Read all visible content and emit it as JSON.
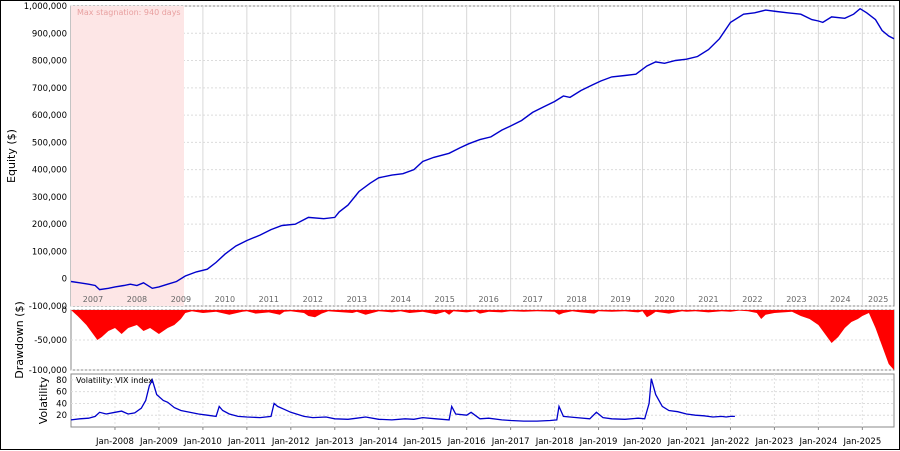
{
  "chart_data": [
    {
      "type": "line",
      "ylabel": "Equity ($)",
      "ylim": [
        -100000,
        1000000
      ],
      "y_ticks": [
        "1,000,000",
        "900,000",
        "800,000",
        "700,000",
        "600,000",
        "500,000",
        "400,000",
        "300,000",
        "200,000",
        "100,000",
        "0",
        "-100,000"
      ],
      "year_labels": [
        "2007",
        "2008",
        "2009",
        "2010",
        "2011",
        "2012",
        "2013",
        "2014",
        "2015",
        "2016",
        "2017",
        "2018",
        "2019",
        "2020",
        "2021",
        "2022",
        "2023",
        "2024",
        "2025"
      ],
      "annotation": "Max stagnation: 940 days",
      "stagnation_range": [
        2007.0,
        2009.57
      ],
      "x_range": [
        2007.0,
        2025.72
      ],
      "series": [
        {
          "color": "#0000cc",
          "x": [
            2007.0,
            2007.2,
            2007.4,
            2007.55,
            2007.65,
            2007.85,
            2008.0,
            2008.2,
            2008.35,
            2008.5,
            2008.65,
            2008.85,
            2009.0,
            2009.2,
            2009.4,
            2009.6,
            2009.85,
            2010.1,
            2010.3,
            2010.5,
            2010.75,
            2011.0,
            2011.3,
            2011.55,
            2011.8,
            2012.1,
            2012.4,
            2012.75,
            2013.0,
            2013.1,
            2013.3,
            2013.55,
            2013.8,
            2014.0,
            2014.3,
            2014.55,
            2014.8,
            2015.0,
            2015.25,
            2015.6,
            2015.85,
            2016.05,
            2016.3,
            2016.55,
            2016.8,
            2017.0,
            2017.25,
            2017.5,
            2017.75,
            2018.0,
            2018.2,
            2018.35,
            2018.6,
            2018.85,
            2019.05,
            2019.3,
            2019.6,
            2019.85,
            2020.1,
            2020.3,
            2020.5,
            2020.75,
            2021.0,
            2021.25,
            2021.5,
            2021.75,
            2022.0,
            2022.3,
            2022.55,
            2022.8,
            2023.05,
            2023.3,
            2023.6,
            2023.85,
            2024.0,
            2024.1,
            2024.3,
            2024.6,
            2024.8,
            2024.95,
            2025.1,
            2025.3,
            2025.45,
            2025.6,
            2025.72
          ],
          "y": [
            -10000,
            -15000,
            -20000,
            -25000,
            -40000,
            -35000,
            -30000,
            -25000,
            -20000,
            -25000,
            -15000,
            -35000,
            -30000,
            -20000,
            -10000,
            10000,
            25000,
            35000,
            60000,
            90000,
            120000,
            140000,
            160000,
            180000,
            195000,
            200000,
            225000,
            220000,
            225000,
            245000,
            270000,
            320000,
            350000,
            370000,
            380000,
            385000,
            400000,
            430000,
            445000,
            460000,
            480000,
            495000,
            510000,
            520000,
            545000,
            560000,
            580000,
            610000,
            630000,
            650000,
            670000,
            665000,
            690000,
            710000,
            725000,
            740000,
            745000,
            750000,
            780000,
            795000,
            790000,
            800000,
            805000,
            815000,
            840000,
            880000,
            940000,
            970000,
            975000,
            985000,
            980000,
            975000,
            970000,
            950000,
            945000,
            940000,
            960000,
            955000,
            970000,
            990000,
            975000,
            950000,
            910000,
            890000,
            880000
          ]
        }
      ]
    },
    {
      "type": "area",
      "ylabel": "Drawdown ($)",
      "ylim": [
        -100000,
        0
      ],
      "y_ticks": [
        "0",
        "-50,000",
        "-100,000"
      ],
      "series": [
        {
          "color": "#ff0000",
          "x": [
            2007.0,
            2007.15,
            2007.35,
            2007.5,
            2007.6,
            2007.7,
            2007.85,
            2008.0,
            2008.15,
            2008.3,
            2008.5,
            2008.65,
            2008.8,
            2009.0,
            2009.2,
            2009.35,
            2009.5,
            2009.6,
            2009.75,
            2010.0,
            2010.3,
            2010.6,
            2010.9,
            2011.0,
            2011.2,
            2011.5,
            2011.75,
            2011.85,
            2012.0,
            2012.3,
            2012.4,
            2012.55,
            2012.7,
            2012.85,
            2013.0,
            2013.4,
            2013.5,
            2013.7,
            2014.0,
            2014.3,
            2014.5,
            2014.7,
            2015.0,
            2015.3,
            2015.5,
            2015.6,
            2015.7,
            2016.0,
            2016.2,
            2016.3,
            2016.5,
            2016.8,
            2017.0,
            2017.3,
            2017.6,
            2018.0,
            2018.1,
            2018.2,
            2018.4,
            2018.6,
            2018.9,
            2019.0,
            2019.3,
            2019.6,
            2019.9,
            2020.0,
            2020.1,
            2020.2,
            2020.3,
            2020.6,
            2020.9,
            2021.0,
            2021.2,
            2021.5,
            2021.8,
            2022.0,
            2022.2,
            2022.4,
            2022.6,
            2022.7,
            2022.8,
            2023.0,
            2023.2,
            2023.4,
            2023.6,
            2023.8,
            2024.0,
            2024.15,
            2024.3,
            2024.45,
            2024.6,
            2024.75,
            2024.9,
            2025.0,
            2025.15,
            2025.3,
            2025.45,
            2025.6,
            2025.72
          ],
          "y": [
            0,
            -10000,
            -25000,
            -40000,
            -50000,
            -45000,
            -35000,
            -30000,
            -40000,
            -30000,
            -25000,
            -35000,
            -30000,
            -40000,
            -30000,
            -25000,
            -15000,
            -5000,
            -2000,
            -5000,
            -3000,
            -8000,
            -3000,
            -2000,
            -6000,
            -4000,
            -8000,
            -3000,
            -2000,
            -5000,
            -10000,
            -12000,
            -6000,
            -2000,
            -3000,
            -5000,
            -3000,
            -8000,
            -2000,
            -4000,
            -2000,
            -5000,
            -3000,
            -7000,
            -3000,
            -8000,
            -2000,
            -4000,
            -2000,
            -6000,
            -3000,
            -4000,
            -2000,
            -3000,
            -2000,
            -3000,
            -8000,
            -5000,
            -2000,
            -4000,
            -6000,
            -2000,
            -3000,
            -2000,
            -4000,
            -2000,
            -12000,
            -8000,
            -3000,
            -6000,
            -2000,
            -3000,
            -2000,
            -4000,
            -2000,
            -3000,
            -1000,
            -2000,
            -5000,
            -15000,
            -8000,
            -5000,
            -4000,
            -3000,
            -10000,
            -15000,
            -25000,
            -40000,
            -55000,
            -45000,
            -30000,
            -20000,
            -15000,
            -10000,
            -5000,
            -30000,
            -60000,
            -90000,
            -100000
          ]
        }
      ]
    },
    {
      "type": "line",
      "ylabel": "Volatility",
      "legend": "Volatility: VIX index",
      "ylim": [
        0,
        90
      ],
      "y_ticks": [
        "80",
        "60",
        "40",
        "20"
      ],
      "x_ticks": [
        "Jan-2008",
        "Jan-2009",
        "Jan-2010",
        "Jan-2011",
        "Jan-2012",
        "Jan-2013",
        "Jan-2014",
        "Jan-2015",
        "Jan-2016",
        "Jan-2017",
        "Jan-2018",
        "Jan-2019",
        "Jan-2020",
        "Jan-2021",
        "Jan-2022",
        "Jan-2023",
        "Jan-2024",
        "Jan-2025"
      ],
      "series": [
        {
          "color": "#0000cc",
          "x": [
            2007.0,
            2007.2,
            2007.4,
            2007.55,
            2007.65,
            2007.8,
            2008.0,
            2008.15,
            2008.3,
            2008.45,
            2008.6,
            2008.7,
            2008.78,
            2008.85,
            2008.95,
            2009.1,
            2009.2,
            2009.35,
            2009.5,
            2009.7,
            2009.9,
            2010.1,
            2010.3,
            2010.37,
            2010.45,
            2010.6,
            2010.8,
            2011.0,
            2011.3,
            2011.55,
            2011.62,
            2011.7,
            2011.85,
            2012.0,
            2012.3,
            2012.5,
            2012.8,
            2013.0,
            2013.3,
            2013.5,
            2013.7,
            2014.0,
            2014.3,
            2014.6,
            2014.8,
            2015.0,
            2015.3,
            2015.6,
            2015.66,
            2015.75,
            2016.0,
            2016.1,
            2016.3,
            2016.5,
            2016.8,
            2017.0,
            2017.3,
            2017.6,
            2017.9,
            2018.05,
            2018.1,
            2018.2,
            2018.5,
            2018.8,
            2018.95,
            2019.1,
            2019.3,
            2019.6,
            2019.9,
            2020.05,
            2020.15,
            2020.2,
            2020.3,
            2020.45,
            2020.6,
            2020.8,
            2021.0,
            2021.2,
            2021.4,
            2021.6,
            2021.8,
            2021.9,
            2022.0,
            2022.1
          ],
          "y": [
            12,
            14,
            15,
            18,
            25,
            22,
            25,
            27,
            22,
            24,
            32,
            45,
            70,
            80,
            55,
            45,
            42,
            33,
            28,
            25,
            22,
            20,
            18,
            35,
            28,
            22,
            18,
            17,
            16,
            18,
            40,
            35,
            30,
            25,
            18,
            16,
            17,
            14,
            13,
            15,
            17,
            13,
            12,
            14,
            13,
            16,
            14,
            12,
            35,
            22,
            20,
            25,
            14,
            15,
            12,
            11,
            10,
            10,
            11,
            12,
            35,
            18,
            16,
            14,
            25,
            16,
            14,
            13,
            15,
            14,
            40,
            82,
            55,
            35,
            28,
            26,
            22,
            20,
            19,
            17,
            18,
            17,
            18,
            18
          ]
        }
      ]
    }
  ]
}
